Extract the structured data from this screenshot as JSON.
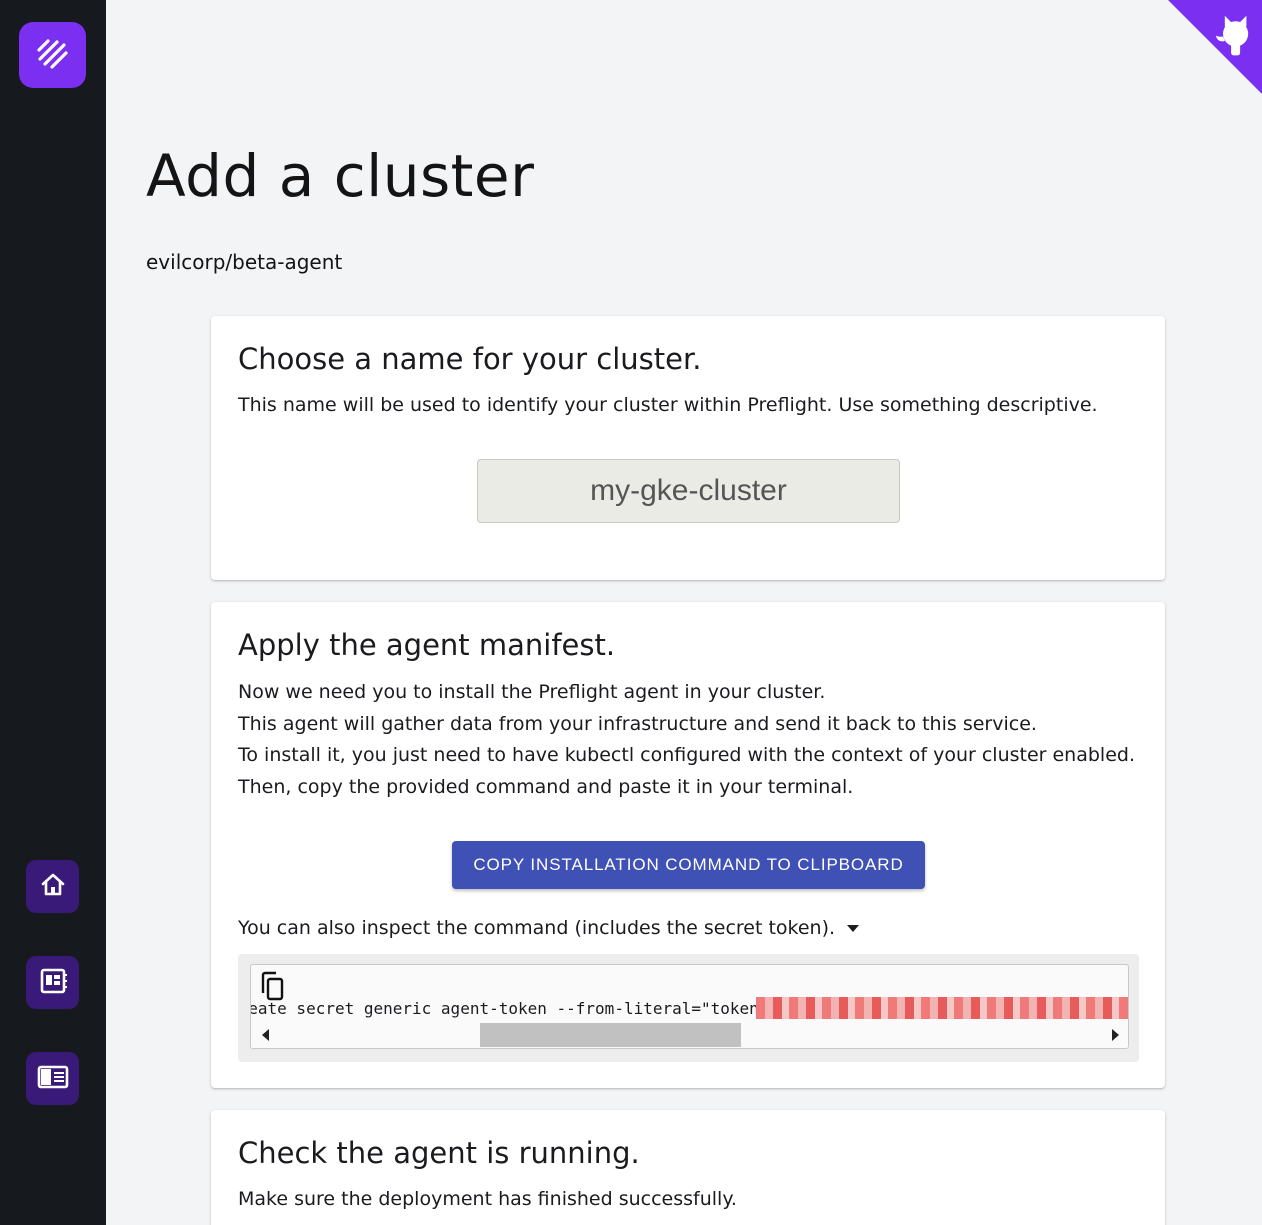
{
  "sidebar": {
    "logo_icon": "preflight-logo-icon",
    "items": [
      {
        "name": "home",
        "icon": "home-icon"
      },
      {
        "name": "dashboard",
        "icon": "dashboard-icon"
      },
      {
        "name": "docs",
        "icon": "docs-icon"
      }
    ]
  },
  "corner_link": {
    "icon": "github-octocat-icon",
    "color": "#7b2ff0"
  },
  "page": {
    "title": "Add a cluster",
    "org_path": "evilcorp/beta-agent"
  },
  "name_card": {
    "heading": "Choose a name for your cluster.",
    "description": "This name will be used to identify your cluster within Preflight. Use something descriptive.",
    "input_value": "my-gke-cluster",
    "input_placeholder": "my-gke-cluster"
  },
  "manifest_card": {
    "heading": "Apply the agent manifest.",
    "lines": [
      "Now we need you to install the Preflight agent in your cluster.",
      "This agent will gather data from your infrastructure and send it back to this service.",
      "To install it, you just need to have kubectl configured with the context of your cluster enabled.",
      "Then, copy the provided command and paste it in your terminal."
    ],
    "copy_button_label": "COPY INSTALLATION COMMAND TO CLIPBOARD",
    "inspect_label": "You can also inspect the command (includes the secret token).",
    "command_visible": "create secret generic agent-token --from-literal=\"token=",
    "token_redacted": true,
    "copy_icon": "copy-icon",
    "accent_color": "#3f51b5"
  },
  "check_card": {
    "heading": "Check the agent is running.",
    "description": "Make sure the deployment has finished successfully."
  }
}
